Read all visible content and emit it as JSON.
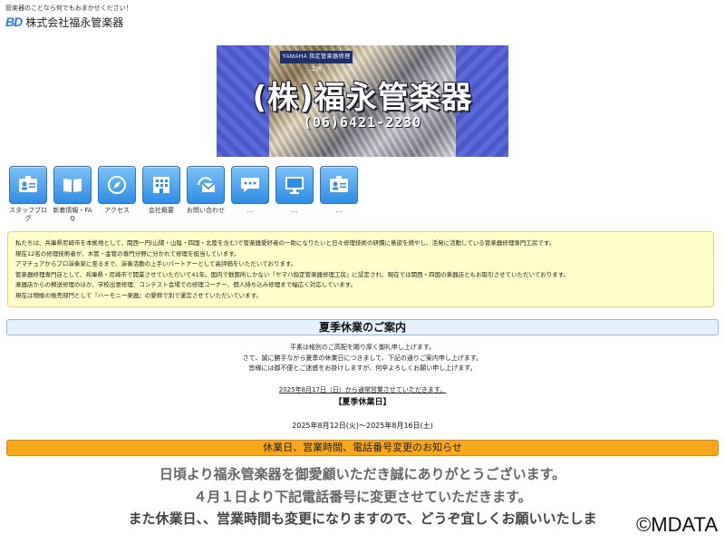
{
  "header": {
    "tagline": "管楽器のことなら何でもおまかせください！",
    "logo_mark": "BD",
    "logo_name": "株式会社福永管楽器"
  },
  "banner": {
    "badge": "YAMAHA 指定管楽器修理工房",
    "title": "(株)福永管楽器",
    "phone": "(06)6421-2230"
  },
  "nav": {
    "items": [
      {
        "label": "スタッフブログ",
        "icon": "id-card-icon"
      },
      {
        "label": "新着情報・FAQ",
        "icon": "book-icon"
      },
      {
        "label": "アクセス",
        "icon": "compass-icon"
      },
      {
        "label": "会社概要",
        "icon": "building-icon"
      },
      {
        "label": "お問い合わせ",
        "icon": "mail-icon"
      },
      {
        "label": "…",
        "icon": "chat-icon"
      },
      {
        "label": "…",
        "icon": "monitor-icon"
      },
      {
        "label": "…",
        "icon": "id-card-icon"
      }
    ]
  },
  "intro": {
    "lines": [
      "私たちは、兵庫県尼崎市を本拠地として、関西一円(山陽・山陰・四国・北陸を含む)で管楽器愛好者の一助になりたいと日々修理技術の研鑽に意欲を燃やし、活発に活動している管楽器修理専門工房です。",
      "現在12名の修理技術者が、木管・金管の専門分野に分かれて修理を担当しています。",
      "アマチュアからプロ演奏家に至るまで、演奏活動の上手いパートナーとして高評価をいただいております。",
      "管楽器修理専門店として、兵庫県・尼崎市で開業させていただいて41年。国内で数箇所しかない『ヤマハ指定管楽器修理工房』に認定され、現在では関西・四国の楽器店ともお取引させていただいております。",
      "楽器店からの郵送修理のほか、学校出張修理、コンテスト会場での修理コーナー、個人持ち込み修理まで幅広く対応しています。",
      "現在は物販の販売部門として『ハーモニー楽器』の愛称で別で運営させていただいています。"
    ]
  },
  "summer": {
    "title": "夏季休業のご案内",
    "lines": [
      "平素は格別のご高配を賜り厚く御礼申し上げます。",
      "さて、誠に勝手ながら夏季の休業日につきまして、下記の通りご案内申し上げます。",
      "皆様には御不便とご迷惑をお掛けしますが、何卒よろしくお願い申し上げます。"
    ],
    "resume": "2025年8月17日（日）から通常営業させていただきます。",
    "period_label": "【夏季休業日】",
    "period": "2025年8月12日(火)～2025年8月16日(土)"
  },
  "change_notice": {
    "title": "休業日、営業時間、電話番号変更のお知らせ",
    "line1": "日頃より福永管楽器を御愛顧いただき誠にありがとうございます。",
    "line2": "４月１日より下記電話番号に変更させていただきます。",
    "line3": "また休業日、、営業時間も変更になりますので、どうぞ宜しくお願いいたしま"
  },
  "watermark": "©MDATA",
  "colors": {
    "accent_blue": "#2f8de4",
    "intro_bg": "#ffffcc",
    "orange": "#f9a81c"
  }
}
